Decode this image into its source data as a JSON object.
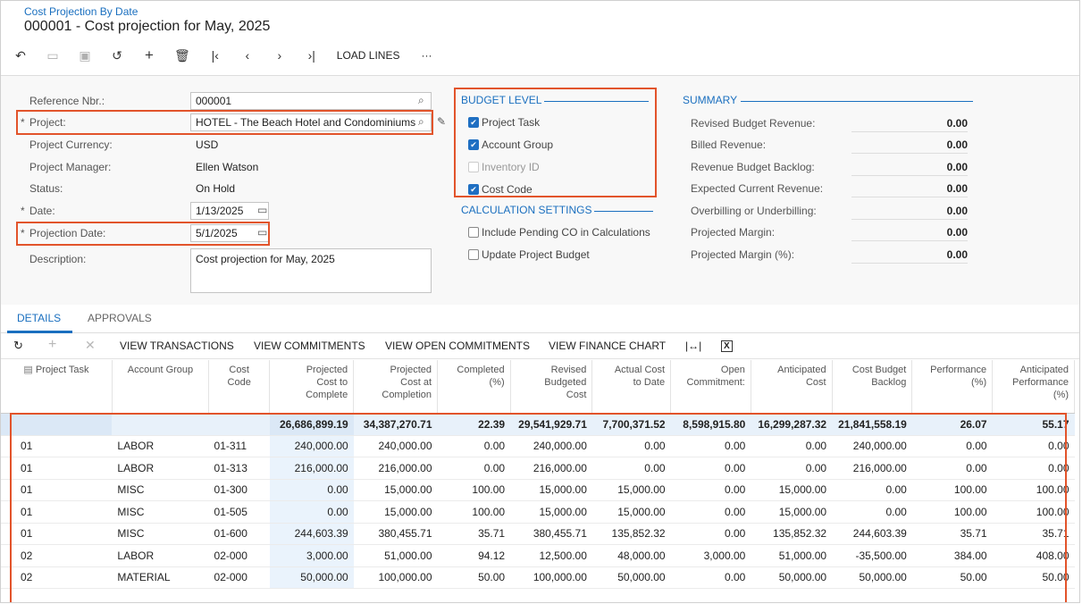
{
  "header": {
    "breadcrumb": "Cost Projection By Date",
    "title": "000001 - Cost projection for May, 2025"
  },
  "toolbar": {
    "load_lines": "LOAD LINES",
    "more": "···"
  },
  "form": {
    "ref_label": "Reference Nbr.:",
    "ref_value": "000001",
    "project_label": "Project:",
    "project_value": "HOTEL - The Beach Hotel and Condominiums",
    "currency_label": "Project Currency:",
    "currency_value": "USD",
    "manager_label": "Project Manager:",
    "manager_value": "Ellen Watson",
    "status_label": "Status:",
    "status_value": "On Hold",
    "date_label": "Date:",
    "date_value": "1/13/2025",
    "projdate_label": "Projection Date:",
    "projdate_value": "5/1/2025",
    "desc_label": "Description:",
    "desc_value": "Cost projection for May, 2025",
    "required_mark": "*"
  },
  "budget_level": {
    "title": "BUDGET LEVEL",
    "items": [
      {
        "label": "Project Task",
        "checked": true
      },
      {
        "label": "Account Group",
        "checked": true
      },
      {
        "label": "Inventory ID",
        "checked": false
      },
      {
        "label": "Cost Code",
        "checked": true
      }
    ]
  },
  "calc": {
    "title": "CALCULATION SETTINGS",
    "items": [
      {
        "label": "Include Pending CO in Calculations",
        "checked": false
      },
      {
        "label": "Update Project Budget",
        "checked": false
      }
    ]
  },
  "summary": {
    "title": "SUMMARY",
    "rows": [
      {
        "label": "Revised Budget Revenue:",
        "value": "0.00"
      },
      {
        "label": "Billed Revenue:",
        "value": "0.00"
      },
      {
        "label": "Revenue Budget Backlog:",
        "value": "0.00"
      },
      {
        "label": "Expected Current Revenue:",
        "value": "0.00"
      },
      {
        "label": "Overbilling or Underbilling:",
        "value": "0.00"
      },
      {
        "label": "Projected Margin:",
        "value": "0.00"
      },
      {
        "label": "Projected Margin (%):",
        "value": "0.00"
      }
    ]
  },
  "tabs": {
    "details": "DETAILS",
    "approvals": "APPROVALS"
  },
  "grid_toolbar": {
    "view_transactions": "VIEW TRANSACTIONS",
    "view_commitments": "VIEW COMMITMENTS",
    "view_open_commitments": "VIEW OPEN COMMITMENTS",
    "view_finance_chart": "VIEW FINANCE CHART"
  },
  "grid": {
    "headers": [
      "Project Task",
      "Account Group",
      "Cost\nCode",
      "Projected\nCost to\nComplete",
      "Projected\nCost at\nCompletion",
      "Completed\n(%)",
      "Revised\nBudgeted\nCost",
      "Actual Cost\nto Date",
      "Open\nCommitment:",
      "Anticipated\nCost",
      "Cost Budget\nBacklog",
      "Performance\n(%)",
      "Anticipated\nPerformance\n(%)"
    ],
    "totals": [
      "",
      "",
      "",
      "26,686,899.19",
      "34,387,270.71",
      "22.39",
      "29,541,929.71",
      "7,700,371.52",
      "8,598,915.80",
      "16,299,287.32",
      "21,841,558.19",
      "26.07",
      "55.17"
    ],
    "rows": [
      [
        "01",
        "LABOR",
        "01-311",
        "240,000.00",
        "240,000.00",
        "0.00",
        "240,000.00",
        "0.00",
        "0.00",
        "0.00",
        "240,000.00",
        "0.00",
        "0.00"
      ],
      [
        "01",
        "LABOR",
        "01-313",
        "216,000.00",
        "216,000.00",
        "0.00",
        "216,000.00",
        "0.00",
        "0.00",
        "0.00",
        "216,000.00",
        "0.00",
        "0.00"
      ],
      [
        "01",
        "MISC",
        "01-300",
        "0.00",
        "15,000.00",
        "100.00",
        "15,000.00",
        "15,000.00",
        "0.00",
        "15,000.00",
        "0.00",
        "100.00",
        "100.00"
      ],
      [
        "01",
        "MISC",
        "01-505",
        "0.00",
        "15,000.00",
        "100.00",
        "15,000.00",
        "15,000.00",
        "0.00",
        "15,000.00",
        "0.00",
        "100.00",
        "100.00"
      ],
      [
        "01",
        "MISC",
        "01-600",
        "244,603.39",
        "380,455.71",
        "35.71",
        "380,455.71",
        "135,852.32",
        "0.00",
        "135,852.32",
        "244,603.39",
        "35.71",
        "35.71"
      ],
      [
        "02",
        "LABOR",
        "02-000",
        "3,000.00",
        "51,000.00",
        "94.12",
        "12,500.00",
        "48,000.00",
        "3,000.00",
        "51,000.00",
        "-35,500.00",
        "384.00",
        "408.00"
      ],
      [
        "02",
        "MATERIAL",
        "02-000",
        "50,000.00",
        "100,000.00",
        "50.00",
        "100,000.00",
        "50,000.00",
        "0.00",
        "50,000.00",
        "50,000.00",
        "50.00",
        "50.00"
      ]
    ]
  },
  "colors": {
    "accent": "#1a6fbf",
    "highlight": "#e2542b"
  }
}
